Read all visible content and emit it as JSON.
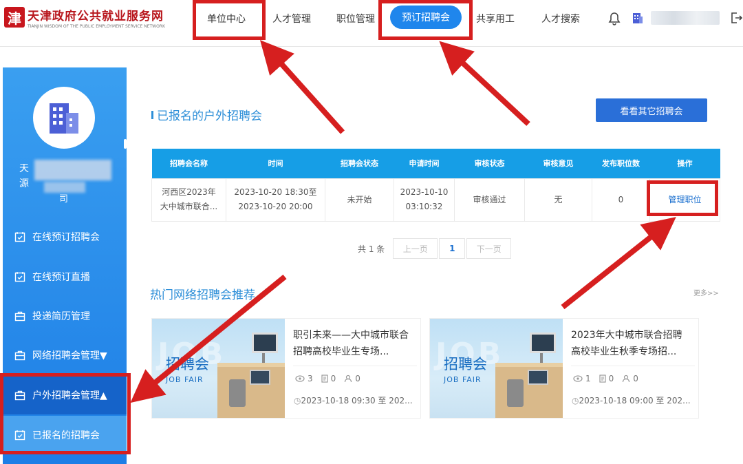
{
  "header": {
    "logo_char": "津",
    "site_title": "天津政府公共就业服务网",
    "site_subtitle": "TIANJIN WISDOM OF THE PUBLIC EMPLOYMENT SERVICE NETWORK",
    "nav": [
      "单位中心",
      "人才管理",
      "职位管理",
      "预订招聘会",
      "共享用工",
      "人才搜索"
    ],
    "icons": [
      "bell-icon",
      "building-icon",
      "logout-icon"
    ]
  },
  "sidebar": {
    "name_line1": "天",
    "name_line2": "源",
    "name_line3": "司",
    "items": [
      {
        "label": "在线预订招聘会",
        "icon": "calendar-check-icon"
      },
      {
        "label": "在线预订直播",
        "icon": "calendar-check-icon"
      },
      {
        "label": "投递简历管理",
        "icon": "briefcase-icon"
      },
      {
        "label": "网络招聘会管理▼",
        "icon": "briefcase-icon"
      },
      {
        "label": "户外招聘会管理▲",
        "icon": "briefcase-icon"
      },
      {
        "label": "已报名的招聘会",
        "icon": "calendar-check-icon"
      }
    ]
  },
  "main": {
    "section_title": "已报名的户外招聘会",
    "other_button": "看看其它招聘会",
    "table": {
      "headers": [
        "招聘会名称",
        "时间",
        "招聘会状态",
        "申请时间",
        "审核状态",
        "审核意见",
        "发布职位数",
        "操作"
      ],
      "row": {
        "name_l1": "河西区2023年",
        "name_l2": "大中城市联合...",
        "time_l1": "2023-10-20 18:30至",
        "time_l2": "2023-10-20 20:00",
        "status": "未开始",
        "apply_l1": "2023-10-10",
        "apply_l2": "03:10:32",
        "review_status": "审核通过",
        "review_opinion": "无",
        "positions": "0",
        "action": "管理职位"
      }
    },
    "pager": {
      "total": "共 1 条",
      "prev": "上一页",
      "page": "1",
      "next": "下一页"
    },
    "hot_title": "热门网络招聘会推荐",
    "more": "更多>>",
    "cards": [
      {
        "img_text": "招聘会",
        "img_sub": "JOB FAIR",
        "title": "职引未来——大中城市联合招聘高校毕业生专场...",
        "views": "3",
        "docs": "0",
        "people": "0",
        "time": "2023-10-18 09:30 至 202..."
      },
      {
        "img_text": "招聘会",
        "img_sub": "JOB FAIR",
        "title": "2023年大中城市联合招聘高校毕业生秋季专场招...",
        "views": "1",
        "docs": "0",
        "people": "0",
        "time": "2023-10-18 09:00 至 202..."
      }
    ]
  },
  "colors": {
    "brand_red": "#b8161c",
    "accent_blue": "#1f86ec",
    "annotation_red": "#d61f1f",
    "table_header": "#169ee6"
  }
}
